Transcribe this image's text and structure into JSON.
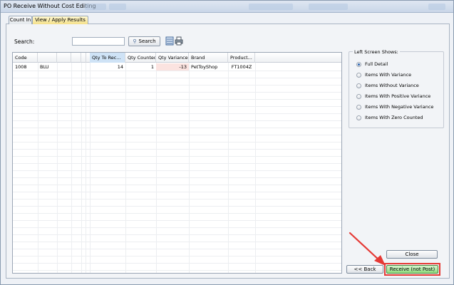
{
  "window": {
    "title": "PO Receive Without Cost Editing"
  },
  "tabs": [
    {
      "label": "Count In",
      "active": false
    },
    {
      "label": "View / Apply Results",
      "active": true
    }
  ],
  "search": {
    "label": "Search:",
    "value": "",
    "button_label": "Search"
  },
  "grid": {
    "columns": [
      "Code",
      "",
      "",
      "",
      "",
      "",
      "Qty To Rec...",
      "Qty Counted",
      "Qty Variance",
      "Brand",
      "Product..."
    ],
    "rows": [
      {
        "code": "1008",
        "name": "BLU",
        "qty_to_receive": "14",
        "qty_counted": "1",
        "qty_variance": "-13",
        "brand": "PetToyShop",
        "product": "FT1004Z"
      }
    ]
  },
  "left_screen": {
    "title": "Left Screen Shows:",
    "options": [
      {
        "label": "Full Detail",
        "selected": true
      },
      {
        "label": "Items With Variance",
        "selected": false
      },
      {
        "label": "Items Without Variance",
        "selected": false
      },
      {
        "label": "Items With Positive Variance",
        "selected": false
      },
      {
        "label": "Items With Negative Variance",
        "selected": false
      },
      {
        "label": "Items With Zero Counted",
        "selected": false
      }
    ]
  },
  "buttons": {
    "close": "Close",
    "back": "<< Back",
    "receive": "Receive (not Post)"
  },
  "colors": {
    "highlight": "#e53935",
    "variance_bg": "#fbe3e0",
    "active_tab": "#f5e08a",
    "receive_button": "#8edb7d"
  }
}
